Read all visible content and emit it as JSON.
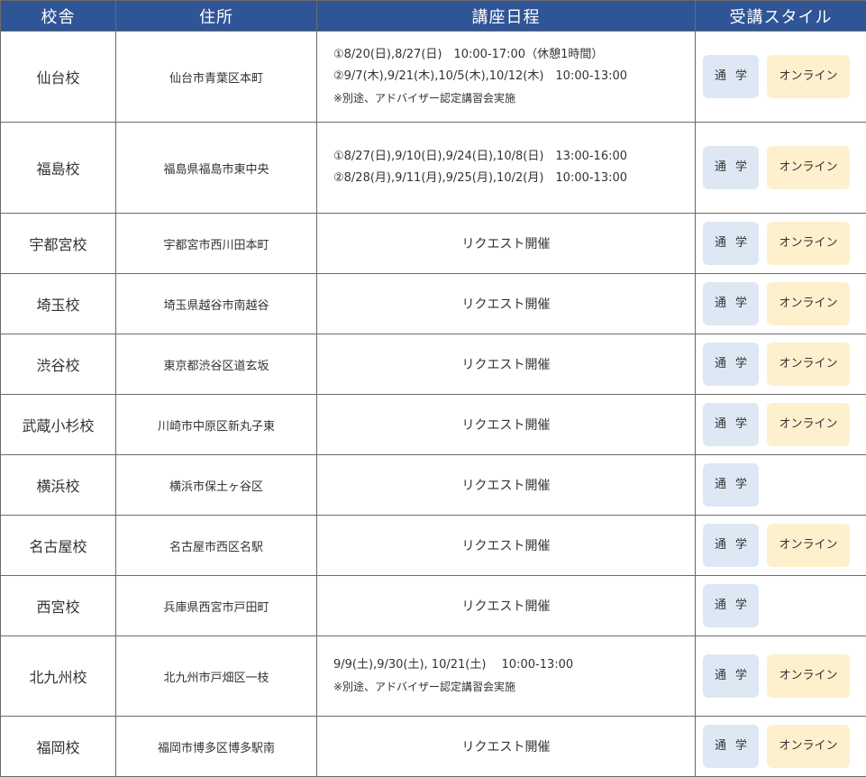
{
  "headers": {
    "campus": "校舎",
    "address": "住所",
    "schedule": "講座日程",
    "style": "受講スタイル"
  },
  "style_labels": {
    "commute": "通学",
    "online": "オンライン"
  },
  "colors": {
    "header_bg": "#2f5597",
    "commute_pill": "#dde8f4",
    "online_pill": "#fdf0cc"
  },
  "rows": [
    {
      "campus": "仙台校",
      "address": "仙台市青葉区本町",
      "schedule_lines": [
        "①8/20(日),8/27(日)　10:00-17:00（休憩1時間）",
        "②9/7(木),9/21(木),10/5(木),10/12(木)　10:00-13:00"
      ],
      "schedule_note": "※別途、アドバイザー認定講習会実施"
    },
    {
      "campus": "福島校",
      "address": "福島県福島市東中央",
      "schedule_lines": [
        "①8/27(日),9/10(日),9/24(日),10/8(日)　13:00-16:00",
        "②8/28(月),9/11(月),9/25(月),10/2(月)　10:00-13:00"
      ]
    },
    {
      "campus": "宇都宮校",
      "address": "宇都宮市西川田本町",
      "schedule": "リクエスト開催"
    },
    {
      "campus": "埼玉校",
      "address": "埼玉県越谷市南越谷",
      "schedule": "リクエスト開催"
    },
    {
      "campus": "渋谷校",
      "address": "東京都渋谷区道玄坂",
      "schedule": "リクエスト開催"
    },
    {
      "campus": "武蔵小杉校",
      "address": "川崎市中原区新丸子東",
      "schedule": "リクエスト開催"
    },
    {
      "campus": "横浜校",
      "address": "横浜市保土ヶ谷区",
      "schedule": "リクエスト開催"
    },
    {
      "campus": "名古屋校",
      "address": "名古屋市西区名駅",
      "schedule": "リクエスト開催"
    },
    {
      "campus": "西宮校",
      "address": "兵庫県西宮市戸田町",
      "schedule": "リクエスト開催"
    },
    {
      "campus": "北九州校",
      "address": "北九州市戸畑区一枝",
      "schedule_lines": [
        "9/9(土),9/30(土), 10/21(土)　 10:00-13:00"
      ],
      "schedule_note": "※別途、アドバイザー認定講習会実施"
    },
    {
      "campus": "福岡校",
      "address": "福岡市博多区博多駅南",
      "schedule": "リクエスト開催"
    }
  ]
}
